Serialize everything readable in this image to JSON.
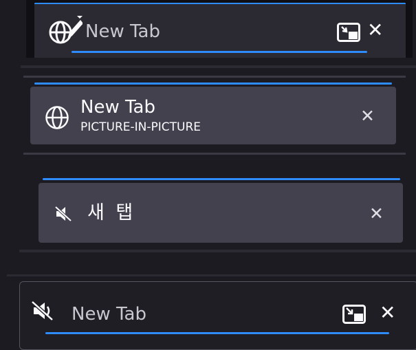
{
  "tabs": [
    {
      "title": "New Tab",
      "icon": "globe-with-pen-icon",
      "pip_icon": "picture-in-picture-icon",
      "close_glyph": "✕"
    },
    {
      "title": "New Tab",
      "subtitle": "PICTURE-IN-PICTURE",
      "icon": "globe-icon",
      "close_glyph": "✕"
    },
    {
      "title": "새 탭",
      "icon": "speaker-muted-icon",
      "close_glyph": "✕"
    },
    {
      "title": "New Tab",
      "icon": "speaker-muted-icon",
      "pip_icon": "picture-in-picture-icon",
      "close_glyph": "✕"
    }
  ],
  "colors": {
    "accent": "#2f8cff",
    "tab_selected_bg": "#42414d",
    "tab_dark_bg": "#2b2a33",
    "background": "#1c1b22"
  }
}
